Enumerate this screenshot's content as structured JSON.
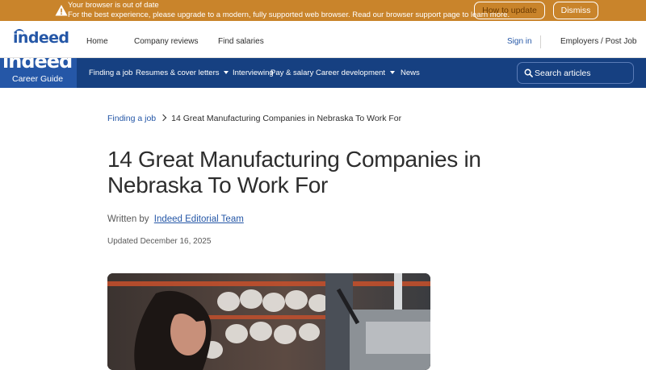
{
  "banner": {
    "line1": "Your browser is out of date",
    "line2": "For the best experience, please upgrade to a modern, fully supported web browser. Read our browser support page to learn more.",
    "update_label": "How to update",
    "dismiss_label": "Dismiss",
    "color": "#c9842b"
  },
  "header": {
    "logo": "indeed",
    "nav": [
      "Home",
      "Company reviews",
      "Find salaries"
    ],
    "signin": "Sign in",
    "employers": "Employers / Post Job"
  },
  "guide": {
    "logo_word": "indeed",
    "label": "Career Guide",
    "items": [
      "Finding a job",
      "Resumes & cover letters",
      "Interviewing",
      "Pay & salary",
      "Career development",
      "News"
    ],
    "search_placeholder": "Search articles",
    "bar_color": "#164081",
    "accent": "#2557a7"
  },
  "article": {
    "breadcrumb": [
      "Finding a job",
      "14 Great Manufacturing Companies in Nebraska To Work For"
    ],
    "title": "14 Great Manufacturing Companies in Nebraska To Work For",
    "written_by": "Written by",
    "author": "Indeed Editorial Team",
    "updated": "Updated December 16, 2025"
  },
  "icons": {
    "banner": "warning-triangle-icon",
    "search": "search-icon",
    "breadcrumb": "chevron-right-icon",
    "dropdown": "caret-down-icon"
  }
}
